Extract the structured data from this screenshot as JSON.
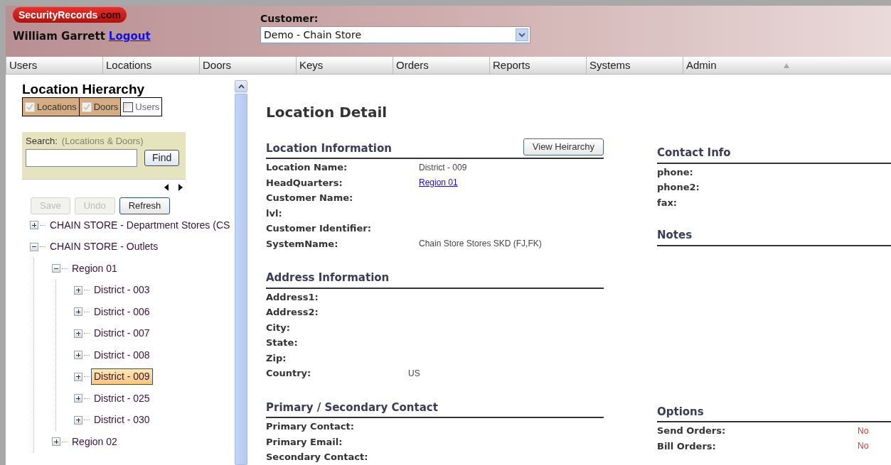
{
  "header": {
    "logo": {
      "brand": "SecurityRecords",
      "suffix": ".com"
    },
    "user": "William Garrett",
    "logout": "Logout",
    "customer_label": "Customer:",
    "customer_value": "Demo - Chain Store"
  },
  "nav": [
    "Users",
    "Locations",
    "Doors",
    "Keys",
    "Orders",
    "Reports",
    "Systems",
    "Admin"
  ],
  "sidebar": {
    "title": "Location Hierarchy",
    "filters": [
      {
        "label": "Locations",
        "checked": true
      },
      {
        "label": "Doors",
        "checked": true
      },
      {
        "label": "Users",
        "checked": false
      }
    ],
    "search": {
      "label": "Search:",
      "hint": "(Locations & Doors)",
      "button": "Find"
    },
    "actions": [
      {
        "label": "Save",
        "disabled": true
      },
      {
        "label": "Undo",
        "disabled": true
      },
      {
        "label": "Refresh",
        "disabled": false
      }
    ],
    "tree": [
      {
        "label": "CHAIN STORE - Department Stores (CS",
        "expanded": false,
        "selected": false
      },
      {
        "label": "CHAIN STORE - Outlets",
        "expanded": true,
        "selected": false,
        "children": [
          {
            "label": "Region 01",
            "expanded": true,
            "selected": false,
            "children": [
              {
                "label": "District - 003",
                "expanded": false,
                "selected": false
              },
              {
                "label": "District - 006",
                "expanded": false,
                "selected": false
              },
              {
                "label": "District - 007",
                "expanded": false,
                "selected": false
              },
              {
                "label": "District - 008",
                "expanded": false,
                "selected": false
              },
              {
                "label": "District - 009",
                "expanded": false,
                "selected": true
              },
              {
                "label": "District - 025",
                "expanded": false,
                "selected": false
              },
              {
                "label": "District - 030",
                "expanded": false,
                "selected": false
              }
            ]
          },
          {
            "label": "Region 02",
            "expanded": false,
            "selected": false
          }
        ]
      }
    ]
  },
  "detail": {
    "title": "Location Detail",
    "left_sections": [
      {
        "title": "Location Information",
        "button": "View Heirarchy",
        "fields": [
          {
            "label": "Location Name:",
            "value": "District - 009"
          },
          {
            "label": "HeadQuarters:",
            "value": "Region 01",
            "kind": "link"
          },
          {
            "label": "Customer Name:"
          },
          {
            "label": "lvl:"
          },
          {
            "label": "Customer Identifier:"
          },
          {
            "label": "SystemName:",
            "value": "Chain Store Stores SKD (FJ,FK)"
          }
        ]
      },
      {
        "title": "Address Information",
        "fields": [
          {
            "label": "Address1:"
          },
          {
            "label": "Address2:"
          },
          {
            "label": "City:"
          },
          {
            "label": "State:"
          },
          {
            "label": "Zip:"
          },
          {
            "label": "Country:",
            "value": "US"
          }
        ]
      },
      {
        "title": "Primary / Secondary Contact",
        "fields": [
          {
            "label": "Primary Contact:"
          },
          {
            "label": "Primary Email:"
          },
          {
            "label": "Secondary Contact:"
          }
        ]
      }
    ],
    "contact": {
      "title": "Contact Info",
      "fields": [
        {
          "label": "phone:"
        },
        {
          "label": "phone2:"
        },
        {
          "label": "fax:"
        }
      ]
    },
    "notes": {
      "title": "Notes"
    },
    "options": {
      "title": "Options",
      "fields": [
        {
          "label": "Send Orders:",
          "value": "No"
        },
        {
          "label": "Bill Orders:",
          "value": "No"
        }
      ]
    }
  }
}
